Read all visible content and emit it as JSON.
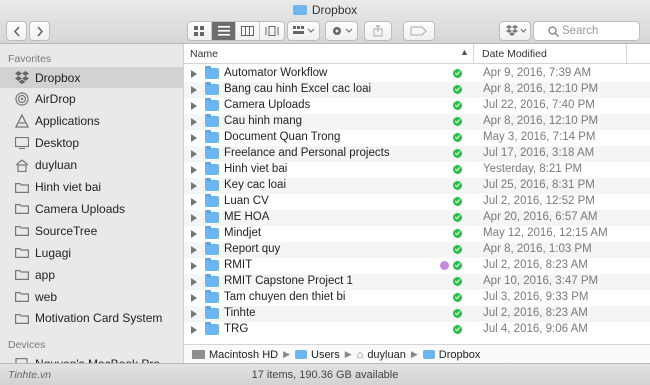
{
  "window": {
    "title": "Dropbox"
  },
  "toolbar": {
    "search_placeholder": "Search",
    "back_icon": "chevron-left-icon",
    "forward_icon": "chevron-right-icon"
  },
  "sidebar": {
    "favorites_label": "Favorites",
    "devices_label": "Devices",
    "items": [
      {
        "label": "Dropbox",
        "icon": "dropbox-icon",
        "selected": true
      },
      {
        "label": "AirDrop",
        "icon": "airdrop-icon"
      },
      {
        "label": "Applications",
        "icon": "applications-icon"
      },
      {
        "label": "Desktop",
        "icon": "desktop-icon"
      },
      {
        "label": "duyluan",
        "icon": "home-icon"
      },
      {
        "label": "Hinh viet bai",
        "icon": "folder-icon"
      },
      {
        "label": "Camera Uploads",
        "icon": "folder-icon"
      },
      {
        "label": "SourceTree",
        "icon": "folder-icon"
      },
      {
        "label": "Lugagi",
        "icon": "folder-icon"
      },
      {
        "label": "app",
        "icon": "folder-icon"
      },
      {
        "label": "web",
        "icon": "folder-icon"
      },
      {
        "label": "Motivation Card System",
        "icon": "folder-icon"
      }
    ],
    "devices": [
      {
        "label": "Nguyen's MacBook Pro",
        "icon": "laptop-icon"
      }
    ]
  },
  "list": {
    "col_name": "Name",
    "col_date": "Date Modified",
    "rows": [
      {
        "name": "Automator Workflow",
        "date": "Apr 9, 2016, 7:39 AM"
      },
      {
        "name": "Bang cau hinh Excel cac loai",
        "date": "Apr 8, 2016, 12:10 PM"
      },
      {
        "name": "Camera Uploads",
        "date": "Jul 22, 2016, 7:40 PM"
      },
      {
        "name": "Cau hinh mang",
        "date": "Apr 8, 2016, 12:10 PM"
      },
      {
        "name": "Document Quan Trong",
        "date": "May 3, 2016, 7:14 PM"
      },
      {
        "name": "Freelance and Personal projects",
        "date": "Jul 17, 2016, 3:18 AM"
      },
      {
        "name": "Hinh viet bai",
        "date": "Yesterday, 8:21 PM"
      },
      {
        "name": "Key cac loai",
        "date": "Jul 25, 2016, 8:31 PM"
      },
      {
        "name": "Luan CV",
        "date": "Jul 2, 2016, 12:52 PM"
      },
      {
        "name": "ME HOA",
        "date": "Apr 20, 2016, 6:57 AM"
      },
      {
        "name": "Mindjet",
        "date": "May 12, 2016, 12:15 AM"
      },
      {
        "name": "Report quy",
        "date": "Apr 8, 2016, 1:03 PM"
      },
      {
        "name": "RMIT",
        "date": "Jul 2, 2016, 8:23 AM",
        "extra_dot": true
      },
      {
        "name": "RMIT Capstone Project 1",
        "date": "Apr 10, 2016, 3:47 PM"
      },
      {
        "name": "Tam chuyen den thiet bi",
        "date": "Jul 3, 2016, 9:33 PM"
      },
      {
        "name": "Tinhte",
        "date": "Jul 2, 2016, 8:23 AM"
      },
      {
        "name": "TRG",
        "date": "Jul 4, 2016, 9:06 AM"
      }
    ]
  },
  "pathbar": [
    "Macintosh HD",
    "Users",
    "duyluan",
    "Dropbox"
  ],
  "status": {
    "text": "17 items, 190.36 GB available",
    "watermark": "Tinhte.vn"
  },
  "colors": {
    "folder": "#6cb5ee",
    "sync": "#2dbb4d",
    "tag": "#c58ad8",
    "selected_bg": "#d2d2d2"
  }
}
